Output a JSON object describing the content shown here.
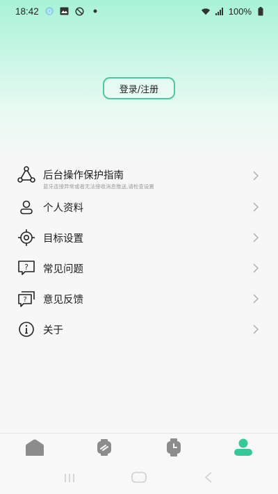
{
  "status_bar": {
    "time": "18:42",
    "battery_text": "100%",
    "icons": [
      "app-notification-icon",
      "gallery-icon",
      "sync-off-icon",
      "dot-icon",
      "wifi-icon",
      "signal-icon",
      "battery-icon"
    ]
  },
  "header": {
    "login_label": "登录/注册"
  },
  "menu": {
    "items": [
      {
        "label": "后台操作保护指南",
        "sub": "蓝牙连接异常或者无法接收消息推送,请检查设置",
        "icon": "share-nodes-icon"
      },
      {
        "label": "个人资料",
        "icon": "person-icon"
      },
      {
        "label": "目标设置",
        "icon": "target-icon"
      },
      {
        "label": "常见问题",
        "icon": "question-chat-icon"
      },
      {
        "label": "意见反馈",
        "icon": "feedback-chat-icon"
      },
      {
        "label": "关于",
        "icon": "info-icon"
      }
    ]
  },
  "tabbar": {
    "tabs": [
      {
        "name": "home-tab",
        "icon": "home-icon",
        "active": false
      },
      {
        "name": "sport-tab",
        "icon": "sport-icon",
        "active": false
      },
      {
        "name": "watch-tab",
        "icon": "watch-icon",
        "active": false
      },
      {
        "name": "profile-tab",
        "icon": "profile-icon",
        "active": true
      }
    ]
  },
  "colors": {
    "accent": "#34c997",
    "inactive": "#8c8c8c",
    "gradient_top": "#a8f3d6"
  }
}
